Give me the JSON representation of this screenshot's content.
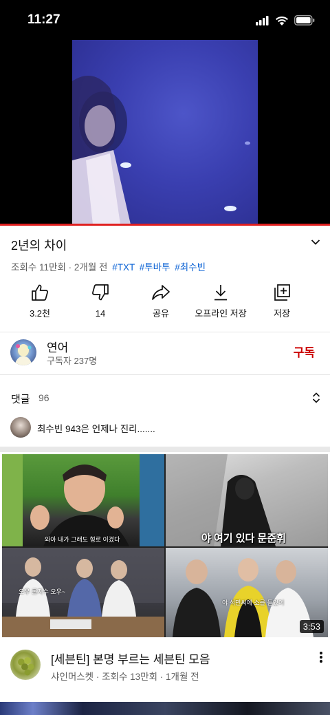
{
  "status_bar": {
    "time": "11:27"
  },
  "video": {
    "title": "2년의 차이",
    "views": "조회수 11만회",
    "date": "2개월 전",
    "tags": [
      "#TXT",
      "#투바투",
      "#최수빈"
    ],
    "progress": 1.0
  },
  "actions": [
    {
      "icon": "thumbs-up-icon",
      "label": "3.2천"
    },
    {
      "icon": "thumbs-down-icon",
      "label": "14"
    },
    {
      "icon": "share-icon",
      "label": "공유"
    },
    {
      "icon": "download-icon",
      "label": "오프라인 저장"
    },
    {
      "icon": "save-icon",
      "label": "저장"
    }
  ],
  "channel": {
    "name": "연어",
    "subscribers": "구독자 237명",
    "subscribe_label": "구독"
  },
  "comments": {
    "label": "댓글",
    "count": "96",
    "top_comment": "최수빈 943은 언제나 진리......."
  },
  "recommended": {
    "thumbnail_captions": [
      "와아 내가 그래도 형로 이겼다",
      "오우 롤지수 오우~",
      "야 여기 있다 문준휘",
      "야 석민씨에 소를 들었어"
    ],
    "duration": "3:53",
    "title": "[세븐틴] 본명 부르는 세븐틴 모음",
    "channel": "샤인머스켓",
    "views": "조회수 13만회",
    "date": "1개월 전"
  },
  "colors": {
    "accent_red": "#cc0000",
    "progress_red": "#e02020",
    "tag_blue": "#065fd4",
    "meta_gray": "#606060"
  }
}
